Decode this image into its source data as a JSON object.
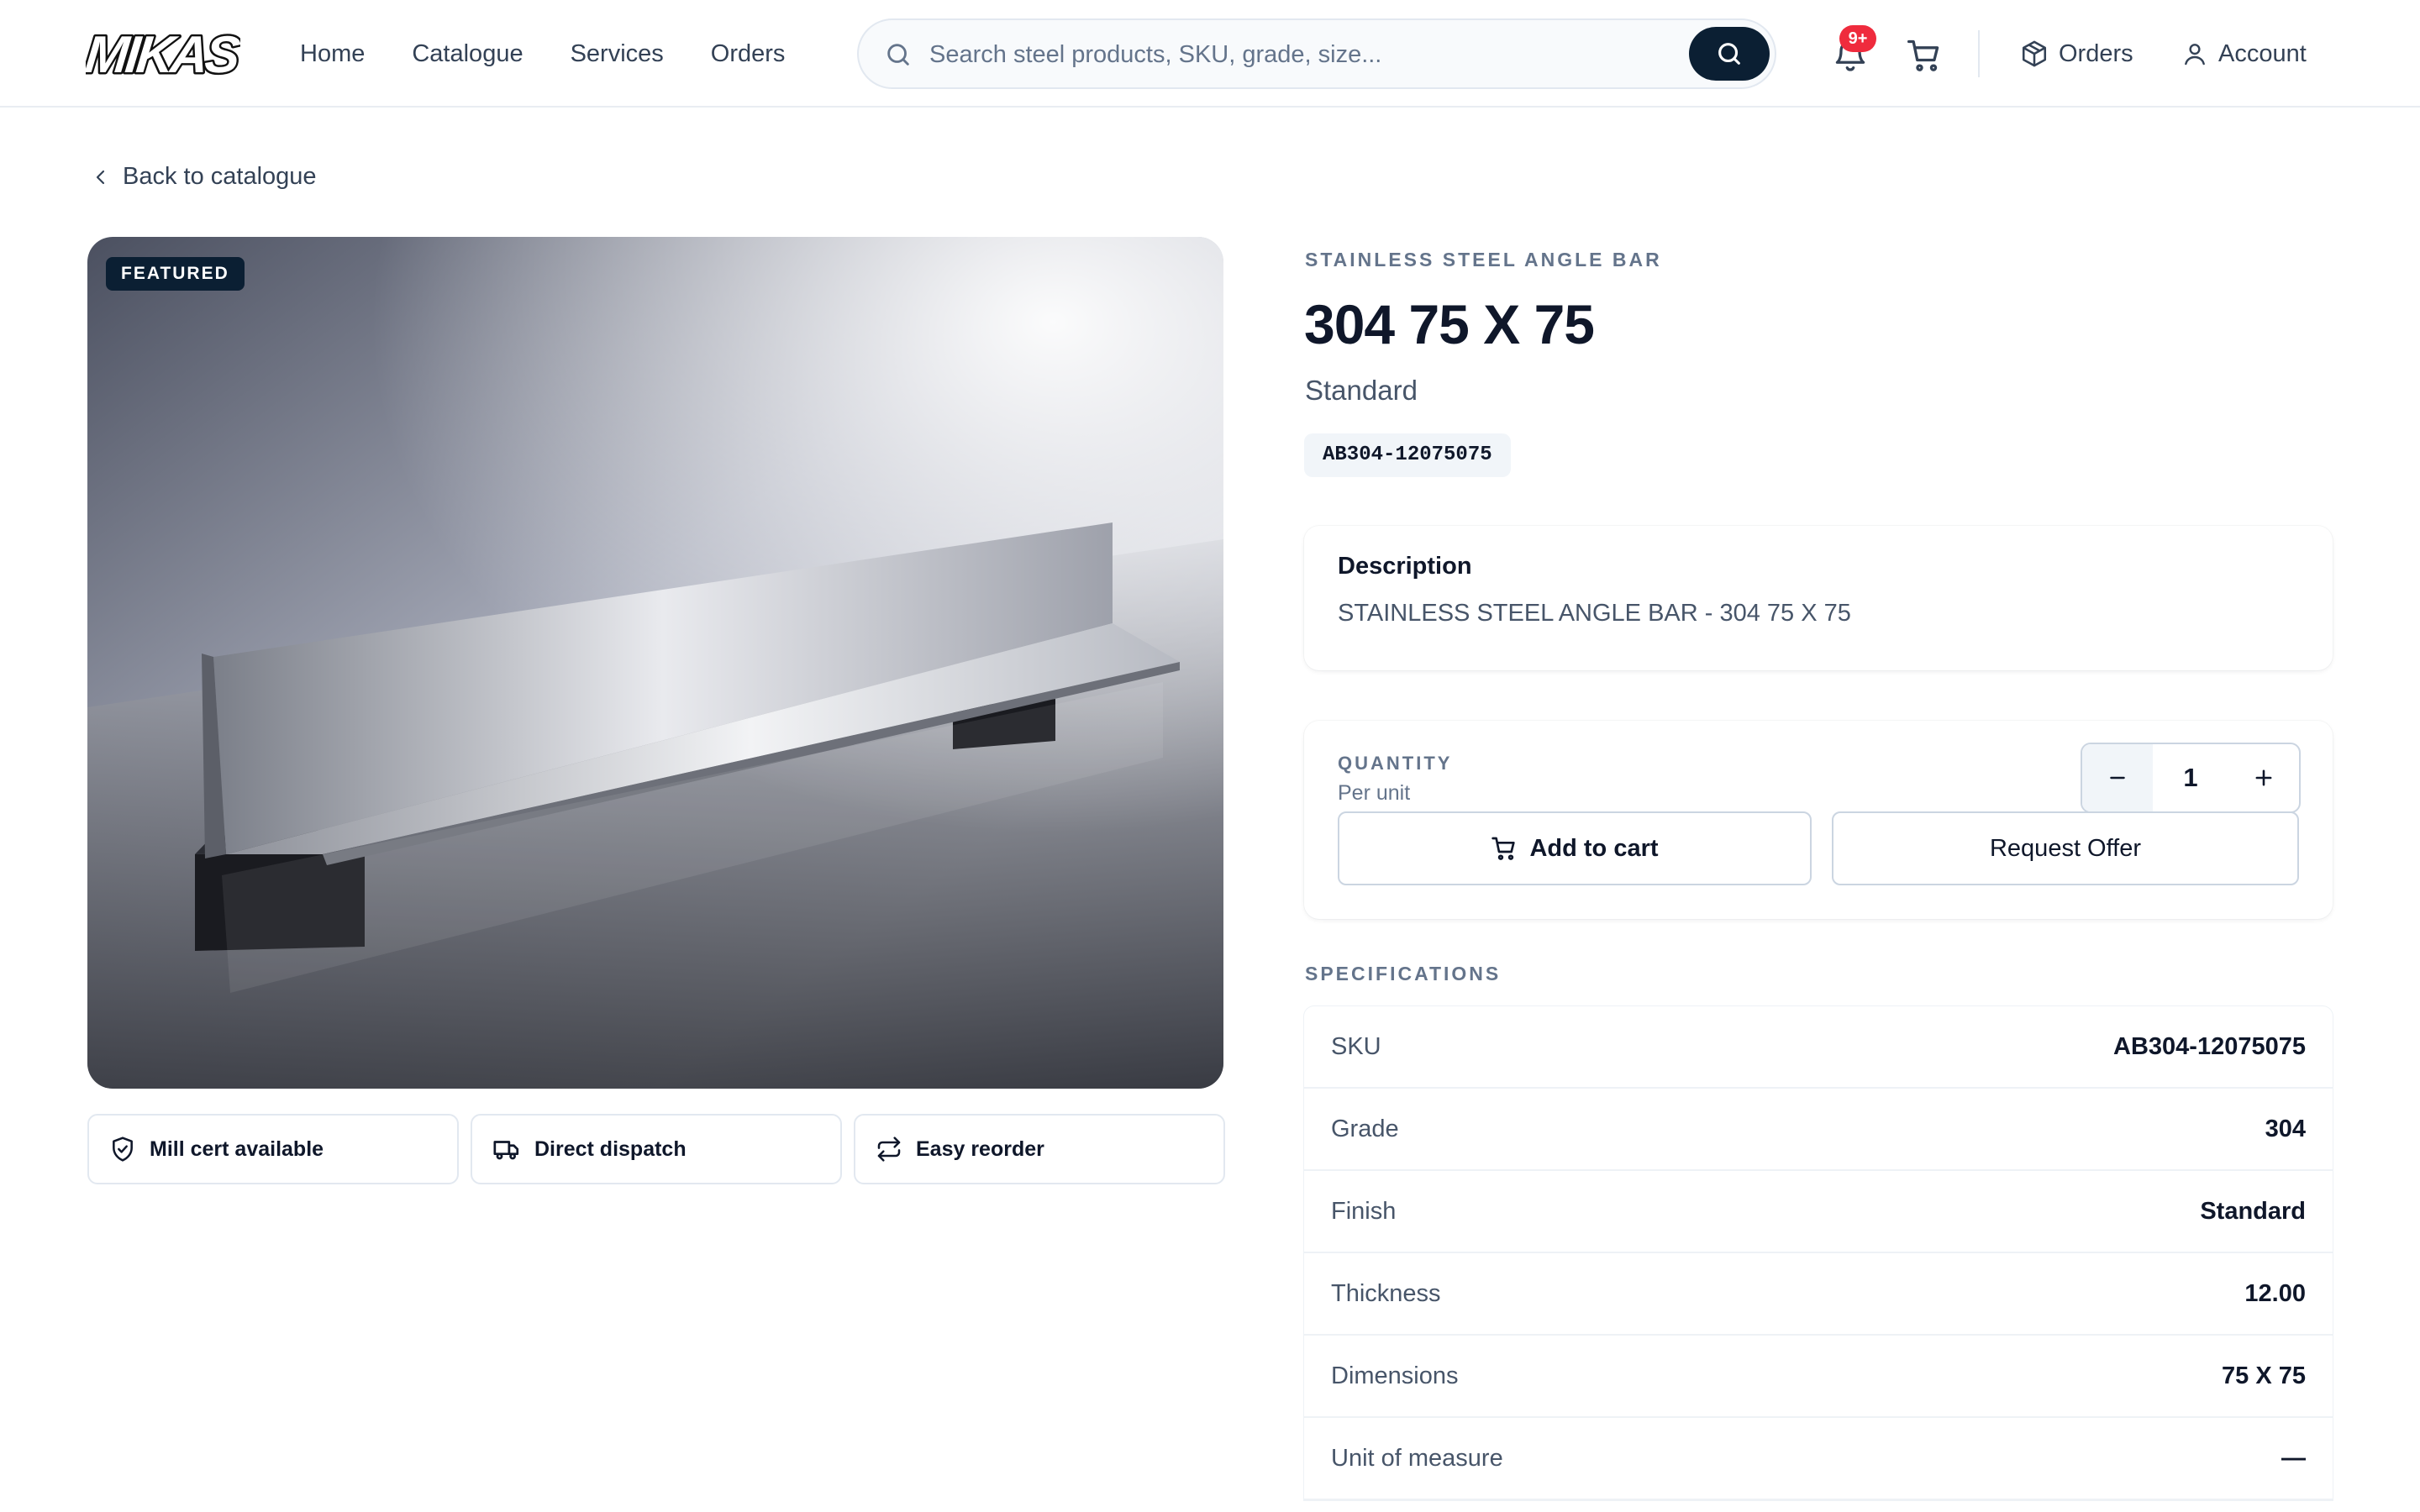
{
  "header": {
    "logo_text": "MIKAS",
    "nav": [
      "Home",
      "Catalogue",
      "Services",
      "Orders"
    ],
    "search_placeholder": "Search steel products, SKU, grade, size...",
    "notification_badge": "9+",
    "orders_label": "Orders",
    "account_label": "Account"
  },
  "back_label": "Back to catalogue",
  "product": {
    "featured_badge": "FEATURED",
    "category": "STAINLESS STEEL ANGLE BAR",
    "title": "304 75 X 75",
    "finish": "Standard",
    "sku": "AB304-12075075"
  },
  "features": [
    "Mill cert available",
    "Direct dispatch",
    "Easy reorder"
  ],
  "description": {
    "heading": "Description",
    "text": "STAINLESS STEEL ANGLE BAR - 304 75 X 75"
  },
  "quantity": {
    "label": "QUANTITY",
    "unit": "Per unit",
    "value": "1",
    "add_to_cart": "Add to cart",
    "request_offer": "Request Offer"
  },
  "specifications": {
    "title": "SPECIFICATIONS",
    "rows": [
      {
        "key": "SKU",
        "value": "AB304-12075075"
      },
      {
        "key": "Grade",
        "value": "304"
      },
      {
        "key": "Finish",
        "value": "Standard"
      },
      {
        "key": "Thickness",
        "value": "12.00"
      },
      {
        "key": "Dimensions",
        "value": "75 X 75"
      },
      {
        "key": "Unit of measure",
        "value": "—"
      }
    ]
  },
  "colors": {
    "navy": "#0b1f33",
    "badge_red": "#ef2b3d",
    "muted": "#64748b"
  }
}
